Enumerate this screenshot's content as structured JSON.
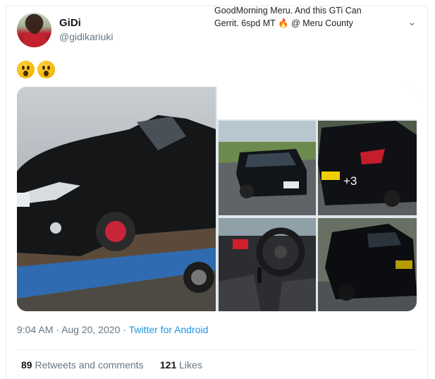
{
  "user": {
    "name": "GiDi",
    "handle": "@gidikariuki"
  },
  "tweet": {
    "emoji_icon": "astonished-face-emoji",
    "emoji_count": 2,
    "media": {
      "caption_lines": [
        "GoodMorning Meru. And this GTi Can",
        "Gerrit. 6spd MT 🔥 @ Meru County"
      ],
      "more_count": "+3"
    }
  },
  "meta": {
    "time": "9:04 AM",
    "separator": "·",
    "date": "Aug 20, 2020",
    "source": "Twitter for Android"
  },
  "stats": {
    "retweets_count": "89",
    "retweets_label": "Retweets and comments",
    "likes_count": "121",
    "likes_label": "Likes"
  },
  "colors": {
    "link": "#1b95e0",
    "secondary_text": "#657786",
    "primary_text": "#14171a"
  }
}
